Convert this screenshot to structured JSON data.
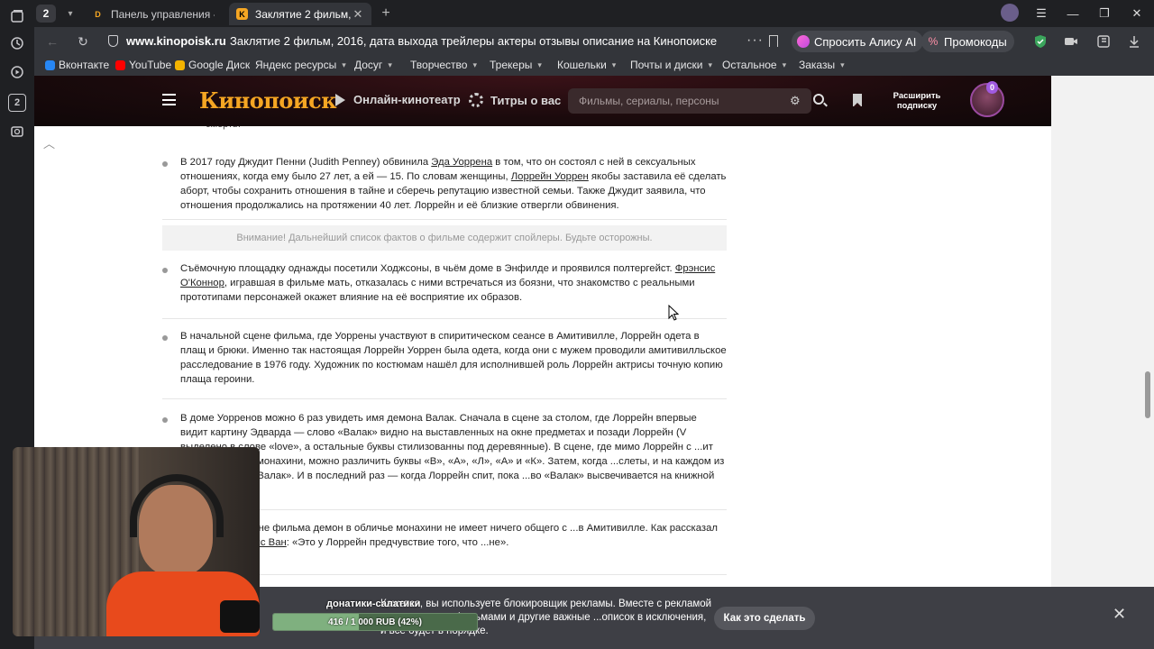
{
  "browser": {
    "tab_count": "2",
    "tabs": [
      {
        "title": "Панель управления - Don",
        "active": false
      },
      {
        "title": "Заклятие 2 фильм, 2016",
        "active": true
      }
    ],
    "url": "www.kinopoisk.ru",
    "page_title": "Заклятие 2 фильм, 2016, дата выхода трейлеры актеры отзывы описание на Кинопоиске",
    "alice_label": "Спросить Алису AI",
    "promo_label": "Промокоды",
    "bookmarks": [
      {
        "label": "Вконтакте",
        "color": "#2787f5",
        "folder": false
      },
      {
        "label": "YouTube",
        "color": "#ff0000",
        "folder": false
      },
      {
        "label": "Google Диск",
        "color": "#f4b400",
        "folder": false
      },
      {
        "label": "Яндекс ресурсы",
        "folder": true
      },
      {
        "label": "Досуг",
        "folder": true
      },
      {
        "label": "Творчество",
        "folder": true
      },
      {
        "label": "Трекеры",
        "folder": true
      },
      {
        "label": "Кошельки",
        "folder": true
      },
      {
        "label": "Почты и диски",
        "folder": true
      },
      {
        "label": "Остальное",
        "folder": true
      },
      {
        "label": "Заказы",
        "folder": true
      }
    ]
  },
  "site": {
    "logo": "Кинопоиск",
    "nav_online": "Онлайн-кинотеатр",
    "nav_titles": "Титры о вас",
    "search_placeholder": "Фильмы, сериалы, персоны",
    "upgrade_line1": "Расширить",
    "upgrade_line2": "подписку",
    "avatar_badge": "0"
  },
  "article": {
    "cut_text": "смерть.",
    "spoiler_warning": "Внимание! Дальнейший список фактов о фильме содержит спойлеры. Будьте осторожны.",
    "facts": [
      {
        "parts": [
          {
            "t": "В 2017 году Джудит Пенни (Judith Penney) обвинила "
          },
          {
            "t": "Эда Уоррена",
            "link": true
          },
          {
            "t": " в том, что он состоял с ней в сексуальных отношениях, когда ему было 27 лет, а ей — 15. По словам женщины, "
          },
          {
            "t": "Лоррейн Уоррен",
            "link": true
          },
          {
            "t": " якобы заставила её сделать аборт, чтобы сохранить отношения в тайне и сберечь репутацию известной семьи. Также Джудит заявила, что отношения продолжались на протяжении 40 лет. Лоррейн и её близкие отвергли обвинения."
          }
        ]
      },
      {
        "parts": [
          {
            "t": "Съёмочную площадку однажды посетили Ходжсоны, в чьём доме в Энфилде и проявился полтергейст. "
          },
          {
            "t": "Фрэнсис О'Коннор",
            "link": true
          },
          {
            "t": ", игравшая в фильме мать, отказалась с ними встречаться из боязни, что знакомство с реальными прототипами персонажей окажет влияние на её восприятие их образов."
          }
        ]
      },
      {
        "parts": [
          {
            "t": "В начальной сцене фильма, где Уоррены участвуют в спиритическом сеансе в Амитивилле, Лоррейн одета в плащ и брюки. Именно так настоящая Лоррейн Уоррен была одета, когда они с мужем проводили амитивилльское расследование в 1976 году. Художник по костюмам нашёл для исполнившей роль Лоррейн актрисы точную копию плаща героини."
          }
        ]
      },
      {
        "parts": [
          {
            "t": "В доме Уорренов можно 6 раз увидеть имя демона Валак. Сначала в сцене за столом, где Лоррейн впервые видит картину Эдварда — слово «Валак» видно на выставленных на окне предметах и позади Лоррейн (V выделено в слове «love», а остальные буквы стилизованны под деревянные). В сцене, где мимо Лоррейн с ...ит демон в облике монахини, можно различить буквы «В», «А», «Л», «А» и «К». Затем, когда ...слеты, и на каждом из трёх написано «Валак». И в последний раз — когда Лоррейн спит, пока ...во «Валак» высвечивается на книжной полке."
          }
        ]
      },
      {
        "parts": [
          {
            "t": "...начальной сцене фильма демон в обличье монахини не имеет ничего общего с ...в Амитивилле. Как рассказал режиссёр "
          },
          {
            "t": "Джеймс Ван",
            "link": true
          },
          {
            "t": ": «Это у Лоррейн предчувствие того, что ...не»."
          }
        ]
      }
    ]
  },
  "adblock": {
    "text": "Кажется, вы используете блокировщик рекламы. Вместе с рекламой он ...ы, папки с фильмами и другие важные ...описок в исключения, и всё будет в порядке.",
    "button": "Как это сделать"
  },
  "donation": {
    "title": "донатики-салатики",
    "label": "416 / 1 000 RUB (42%)",
    "progress": 0.42
  },
  "colors": {
    "logo": "#f5a623",
    "chrome": "#33353a",
    "banner": "#3e3f45"
  }
}
